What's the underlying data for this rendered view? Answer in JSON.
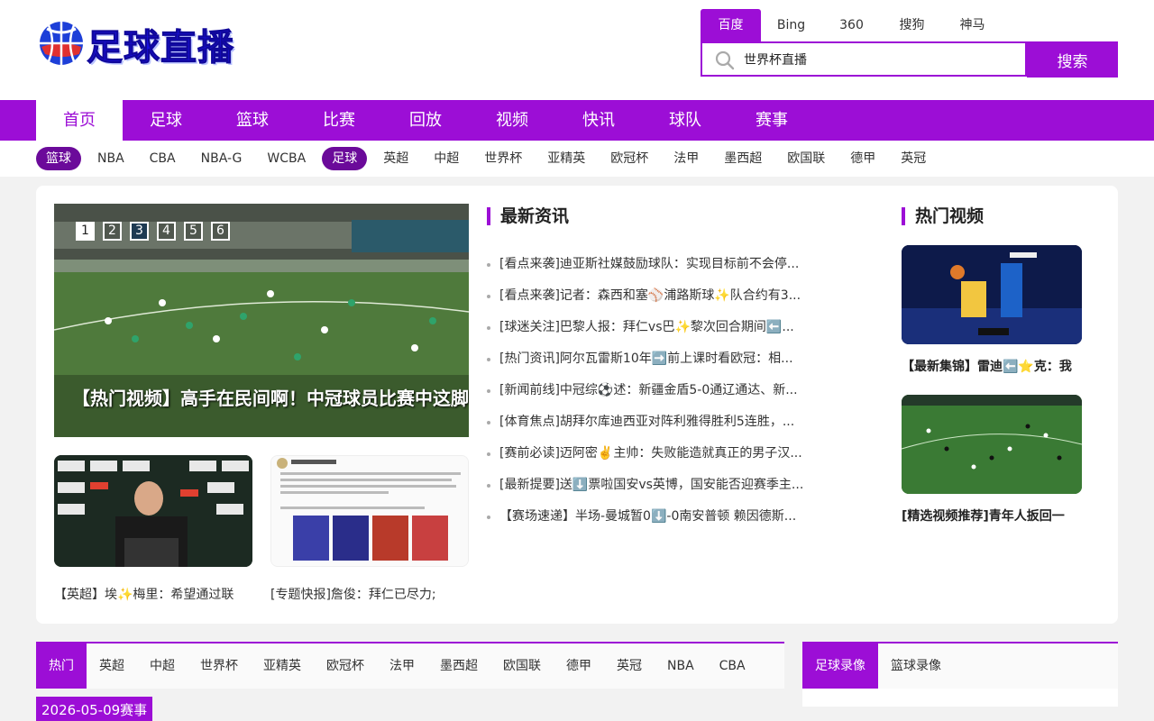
{
  "logo": {
    "text": "足球直播"
  },
  "search": {
    "engines": [
      "百度",
      "Bing",
      "360",
      "搜狗",
      "神马"
    ],
    "active_engine": "百度",
    "value": "世界杯直播",
    "button": "搜索"
  },
  "mainnav": [
    "首页",
    "足球",
    "篮球",
    "比赛",
    "回放",
    "视频",
    "快讯",
    "球队",
    "赛事"
  ],
  "subnav": [
    "篮球",
    "NBA",
    "CBA",
    "NBA-G",
    "WCBA",
    "足球",
    "英超",
    "中超",
    "世界杯",
    "亚精英",
    "欧冠杯",
    "法甲",
    "墨西超",
    "欧国联",
    "德甲",
    "英冠"
  ],
  "slider": {
    "pages": [
      "1",
      "2",
      "3",
      "4",
      "5",
      "6"
    ],
    "caption": "【热门视频】高手在民间啊！中冠球员比赛中这脚"
  },
  "thumbs": [
    {
      "caption": "【英超】埃✨梅里：希望通过联"
    },
    {
      "caption": "[专题快报]詹俊：拜仁已尽力;"
    }
  ],
  "news": {
    "title": "最新资讯",
    "items": [
      "[看点来袭]迪亚斯社媒鼓励球队：实现目标前不会停...",
      "[看点来袭]记者：森西和塞⚾浦路斯球✨队合约有3...",
      "[球迷关注]巴黎人报：拜仁vs巴✨黎次回合期间⬅️...",
      "[热门资讯]阿尔瓦雷斯10年➡️前上课时看欧冠：相...",
      "[新闻前线]中冠综⚽述：新疆金盾5-0通辽通达、新...",
      "[体育焦点]胡拜尔库迪西亚对阵利雅得胜利5连胜，...",
      "[赛前必读]迈阿密✌️主帅：失败能造就真正的男子汉...",
      "[最新提要]送⬇️票啦国安vs英博，国安能否迎赛季主...",
      "【赛场速递】半场-曼城暂0⬇️-0南安普顿 赖因德斯..."
    ]
  },
  "videos": {
    "title": "热门视频",
    "items": [
      {
        "caption": "【最新集锦】雷迪⬅️⭐克：我"
      },
      {
        "caption": "[精选视频推荐]青年人扳回一"
      }
    ]
  },
  "bottom": {
    "tabs": [
      "热门",
      "英超",
      "中超",
      "世界杯",
      "亚精英",
      "欧冠杯",
      "法甲",
      "墨西超",
      "欧国联",
      "德甲",
      "英冠",
      "NBA",
      "CBA"
    ],
    "rec_tabs": [
      "足球录像",
      "篮球录像"
    ],
    "date": "2026-05-09赛事"
  },
  "colors": {
    "accent": "#9c0ed6",
    "pill": "#6b0a9a",
    "logo_blue": "#1a10e0"
  },
  "icons": {
    "search": "search-icon",
    "logo": "basketball-logo-icon"
  }
}
